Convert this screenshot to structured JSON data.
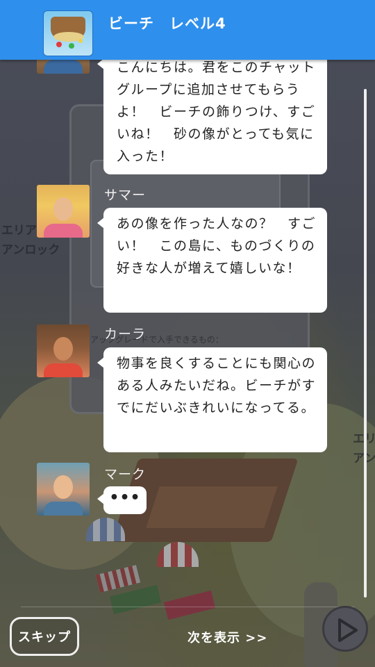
{
  "header": {
    "title": "ビーチ　レベル4",
    "thumbnail_icon": "beach-island-thumbnail"
  },
  "background": {
    "text_left": "エリア\nアンロック",
    "text_right": "エリ\nアン",
    "panel_text": "アップグレードで入手できるもの："
  },
  "messages": [
    {
      "sender": "",
      "avatar_icon": "first-character-avatar",
      "text": "こんにちは。君をこのチャットグループに追加させてもらうよ！　ビーチの飾りつけ、すごいね！　砂の像がとっても気に入った！"
    },
    {
      "sender": "サマー",
      "avatar_icon": "summer-avatar",
      "text": "あの像を作った人なの？　すごい！　この島に、ものづくりの好きな人が増えて嬉しいな！"
    },
    {
      "sender": "カーラ",
      "avatar_icon": "karla-avatar",
      "text": "物事を良くすることにも関心のある人みたいだね。ビーチがすでにだいぶきれいになってる。"
    },
    {
      "sender": "マーク",
      "avatar_icon": "mark-avatar",
      "text": "•••"
    }
  ],
  "controls": {
    "skip_label": "スキップ",
    "next_label": "次を表示 >>",
    "play_icon": "play-icon"
  },
  "colors": {
    "header": "#2f8fec",
    "bubble": "#ffffff",
    "text": "#222222"
  }
}
